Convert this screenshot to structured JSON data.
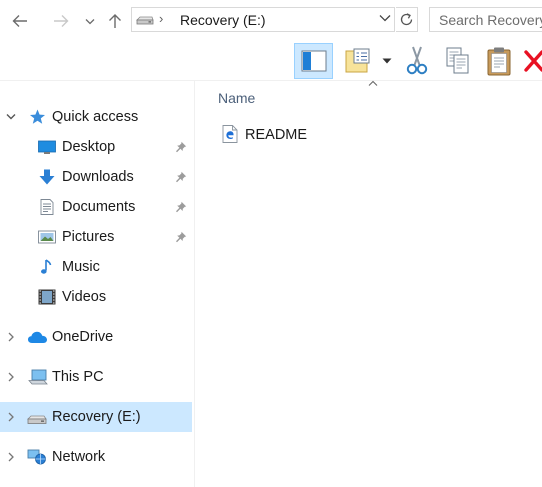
{
  "address_bar": {
    "path": "Recovery (E:)"
  },
  "search": {
    "placeholder": "Search Recovery (E:)"
  },
  "nav_pane": {
    "items": [
      {
        "label": "Quick access"
      },
      {
        "label": "Desktop"
      },
      {
        "label": "Downloads"
      },
      {
        "label": "Documents"
      },
      {
        "label": "Pictures"
      },
      {
        "label": "Music"
      },
      {
        "label": "Videos"
      },
      {
        "label": "OneDrive"
      },
      {
        "label": "This PC"
      },
      {
        "label": "Recovery (E:)"
      },
      {
        "label": "Network"
      }
    ],
    "selected": "Recovery (E:)"
  },
  "content": {
    "columns": [
      "Name"
    ],
    "sort_column": "Name",
    "files": [
      {
        "name": "README",
        "icon": "edge-html-file-icon"
      }
    ]
  },
  "colors": {
    "selection": "#cce8ff",
    "selection_border": "#99d1ff",
    "accent_blue": "#1e88e5",
    "delete_red": "#e81123",
    "column_header": "#4c607a"
  }
}
